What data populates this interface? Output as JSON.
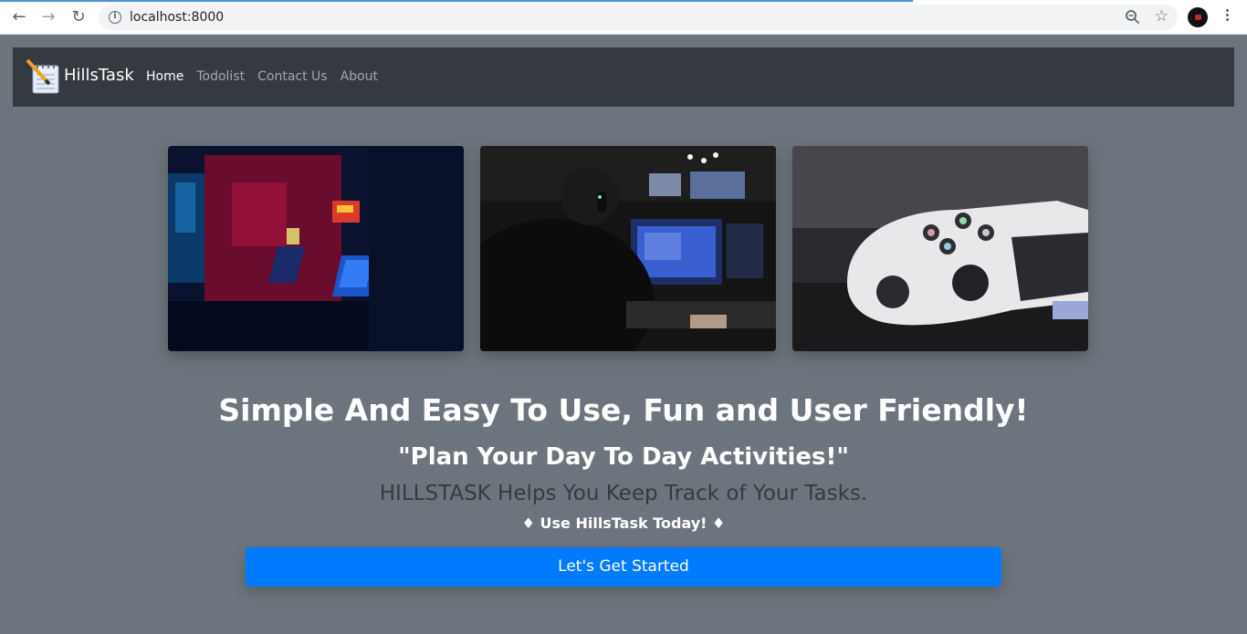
{
  "browser": {
    "url": "localhost:8000",
    "icons": [
      "back-icon",
      "forward-icon",
      "reload-icon",
      "info-icon",
      "zoom-icon",
      "star-icon",
      "profile-avatar",
      "menu-icon"
    ]
  },
  "navbar": {
    "brand": "HillsTask",
    "links": [
      {
        "label": "Home",
        "active": true
      },
      {
        "label": "Todolist",
        "active": false
      },
      {
        "label": "Contact Us",
        "active": false
      },
      {
        "label": "About",
        "active": false
      }
    ]
  },
  "gallery": [
    {
      "name": "arcade-image"
    },
    {
      "name": "gamer-image"
    },
    {
      "name": "controller-image"
    }
  ],
  "hero": {
    "headline": "Simple And Easy To Use, Fun and User Friendly!",
    "quote": "\"Plan Your Day To Day Activities!\"",
    "tagline": "HILLSTASK Helps You Keep Track of Your Tasks.",
    "cta_line": "♦ Use HillsTask Today! ♦",
    "cta_button": "Let's Get Started"
  },
  "colors": {
    "page_bg": "#6c757d",
    "navbar_bg": "#343a40",
    "primary": "#007bff"
  }
}
